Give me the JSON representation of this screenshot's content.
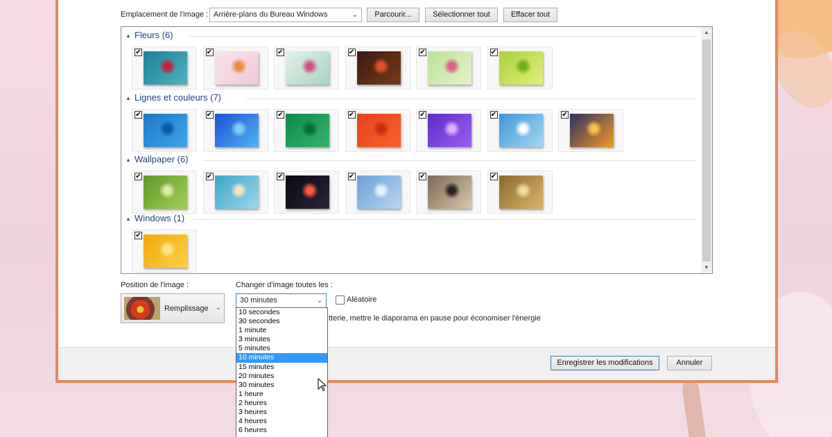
{
  "location": {
    "label": "Emplacement de l'image :",
    "value": "Arrière-plans du Bureau Windows",
    "browse": "Parcourir...",
    "select_all": "Sélectionner tout",
    "clear_all": "Effacer tout"
  },
  "groups": [
    {
      "title": "Fleurs (6)",
      "items": [
        {
          "name": "fleur-1",
          "colors": [
            "#1c7f93",
            "#4fb3c0"
          ],
          "accent": "#c8203a"
        },
        {
          "name": "fleur-2",
          "colors": [
            "#f7e3ec",
            "#f2c9d9"
          ],
          "accent": "#e98b3c"
        },
        {
          "name": "fleur-3",
          "colors": [
            "#e3f1ea",
            "#a7d4c0"
          ],
          "accent": "#d44f8a"
        },
        {
          "name": "fleur-4",
          "colors": [
            "#3a1a12",
            "#7a3b18"
          ],
          "accent": "#e2512a"
        },
        {
          "name": "fleur-5",
          "colors": [
            "#b8e39a",
            "#e6f3c8"
          ],
          "accent": "#e05b8a"
        },
        {
          "name": "fleur-6",
          "colors": [
            "#a8d23a",
            "#e1ef7a"
          ],
          "accent": "#6fae1f"
        }
      ]
    },
    {
      "title": "Lignes et couleurs (7)",
      "items": [
        {
          "name": "ligne-1",
          "colors": [
            "#1a78c8",
            "#42a6e8"
          ],
          "accent": "#0d5aa3"
        },
        {
          "name": "ligne-2",
          "colors": [
            "#1e4fd8",
            "#4fb6ef"
          ],
          "accent": "#7ad0f2"
        },
        {
          "name": "ligne-3",
          "colors": [
            "#0c8b4a",
            "#35b36c"
          ],
          "accent": "#0a6a37"
        },
        {
          "name": "ligne-4",
          "colors": [
            "#e8401a",
            "#f7642c"
          ],
          "accent": "#c72d0f"
        },
        {
          "name": "ligne-5",
          "colors": [
            "#5b2bc9",
            "#9c5ff0"
          ],
          "accent": "#d6b3ff"
        },
        {
          "name": "ligne-6",
          "colors": [
            "#3f97d8",
            "#a6d6f2"
          ],
          "accent": "#ffffff"
        },
        {
          "name": "ligne-7",
          "colors": [
            "#2d2f63",
            "#f29a24"
          ],
          "accent": "#f7c04a"
        }
      ]
    },
    {
      "title": "Wallpaper (6)",
      "items": [
        {
          "name": "wall-1",
          "colors": [
            "#5e9a2a",
            "#a2cf54"
          ],
          "accent": "#d8eda0"
        },
        {
          "name": "wall-2",
          "colors": [
            "#3aa5c8",
            "#9fd7ea"
          ],
          "accent": "#efe6c2"
        },
        {
          "name": "wall-3",
          "colors": [
            "#0a0a14",
            "#2a2438"
          ],
          "accent": "#ff5a3c"
        },
        {
          "name": "wall-4",
          "colors": [
            "#6aa0d8",
            "#b9d6f0"
          ],
          "accent": "#e8f2fb"
        },
        {
          "name": "wall-5",
          "colors": [
            "#7a6a58",
            "#d8c7a8"
          ],
          "accent": "#2a2320"
        },
        {
          "name": "wall-6",
          "colors": [
            "#8a6a2e",
            "#d9b46a"
          ],
          "accent": "#f0dba0"
        }
      ]
    },
    {
      "title": "Windows (1)",
      "items": [
        {
          "name": "win-1",
          "colors": [
            "#f2a80c",
            "#fbd044"
          ],
          "accent": "#fce58e"
        }
      ]
    }
  ],
  "position": {
    "label": "Position de l'image :",
    "value": "Remplissage"
  },
  "interval": {
    "label": "Changer d'image toutes les :",
    "value": "30 minutes",
    "options": [
      "10 secondes",
      "30 secondes",
      "1 minute",
      "3 minutes",
      "5 minutes",
      "10 minutes",
      "15 minutes",
      "20 minutes",
      "30 minutes",
      "1 heure",
      "2 heures",
      "3 heures",
      "4 heures",
      "6 heures"
    ],
    "highlighted_index": 5
  },
  "shuffle": {
    "label": "Aléatoire",
    "checked": false
  },
  "battery_text": "tterie, mettre le diaporama en pause pour économiser l'énergie",
  "footer": {
    "save": "Enregistrer les modifications",
    "cancel": "Annuler"
  }
}
